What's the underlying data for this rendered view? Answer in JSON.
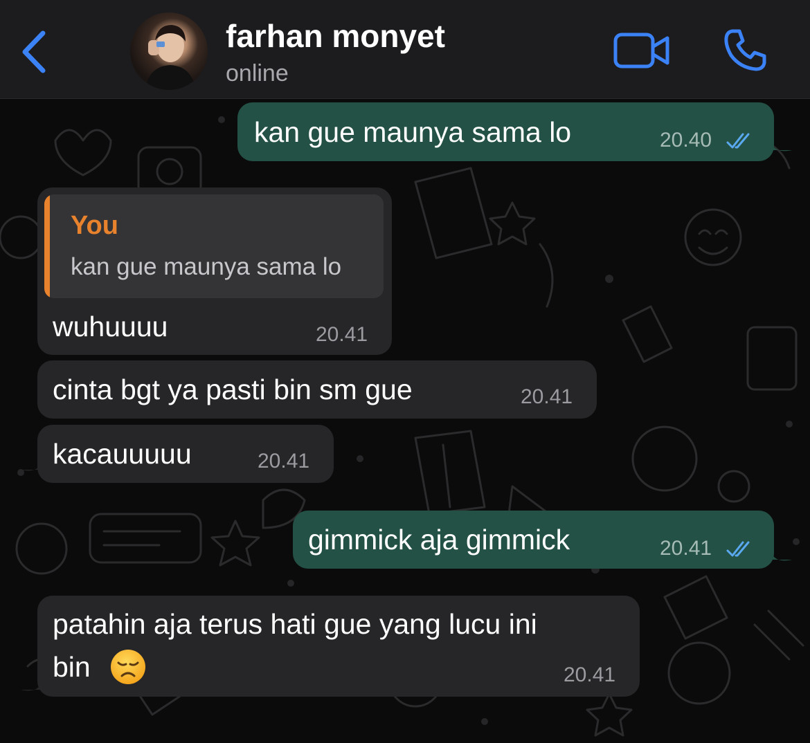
{
  "header": {
    "contact_name": "farhan monyet",
    "status": "online",
    "icons": {
      "back": "chevron-left-icon",
      "video": "video-camera-icon",
      "call": "phone-icon"
    },
    "accent_color": "#3b82f6"
  },
  "messages": [
    {
      "direction": "outgoing",
      "text": "kan gue maunya sama lo",
      "time": "20.40",
      "read": true
    },
    {
      "direction": "incoming",
      "reply_to": {
        "author": "You",
        "text": "kan gue maunya sama lo"
      },
      "text": "wuhuuuu",
      "time": "20.41"
    },
    {
      "direction": "incoming",
      "text": "cinta bgt ya pasti bin sm gue",
      "time": "20.41"
    },
    {
      "direction": "incoming",
      "text": "kacauuuuu",
      "time": "20.41"
    },
    {
      "direction": "outgoing",
      "text": "gimmick aja gimmick",
      "time": "20.41",
      "read": true
    },
    {
      "direction": "incoming",
      "text_line1": "patahin aja terus hati gue yang lucu ini",
      "text_line2": "bin",
      "emoji": "disappointed-face-icon",
      "time": "20.41"
    }
  ],
  "colors": {
    "outgoing_bubble": "#245145",
    "incoming_bubble": "#262628",
    "quote_accent": "#e9822d",
    "read_ticks": "#5aa9f0"
  }
}
